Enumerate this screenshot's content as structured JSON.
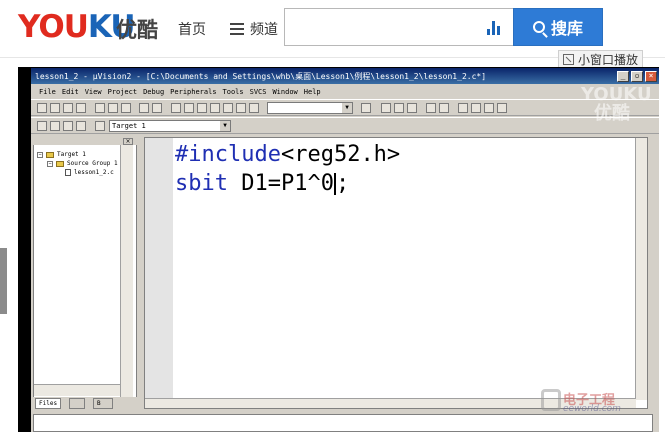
{
  "header": {
    "logo_you": "YOU",
    "logo_ku": "KU",
    "logo_cn": "优酷",
    "nav_home": "首页",
    "nav_channel": "频道",
    "search_value": "",
    "search_button": "搜库",
    "mini_player": "小窗口播放"
  },
  "ide": {
    "title": "lesson1_2  - µVision2 - [C:\\Documents and Settings\\whb\\桌面\\Lesson1\\例程\\lesson1_2\\lesson1_2.c*]",
    "menus": [
      "File",
      "Edit",
      "View",
      "Project",
      "Debug",
      "Peripherals",
      "Tools",
      "SVCS",
      "Window",
      "Help"
    ],
    "target_combo": "Target 1",
    "tree": [
      {
        "label": "Target 1"
      },
      {
        "label": "Source Group 1"
      },
      {
        "label": "lesson1_2.c"
      }
    ],
    "tabs": [
      "Files",
      "",
      "B"
    ],
    "code": {
      "line1_kw": "#include",
      "line1_rest": "<reg52.h>",
      "line2_kw": "sbit",
      "line2_rest": " D1=P1^0",
      "line2_end": ";"
    }
  },
  "watermark": {
    "line1": "YOUKU",
    "line2": "优酷"
  },
  "eeworld": {
    "cn": "电子工程",
    "en": "eeworld.com"
  }
}
